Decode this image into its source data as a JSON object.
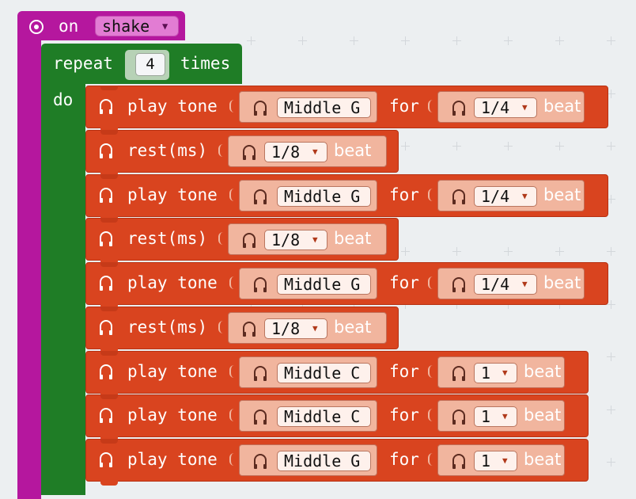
{
  "event": {
    "label": "on",
    "gesture": "shake"
  },
  "repeat": {
    "label": "repeat",
    "count": "4",
    "times_label": "times",
    "do_label": "do"
  },
  "statements": [
    {
      "kind": "tone",
      "label": "play tone",
      "note": "Middle G",
      "for_label": "for",
      "beat": "1/4",
      "beat_label": "beat"
    },
    {
      "kind": "rest",
      "label": "rest(ms)",
      "beat": "1/8",
      "beat_label": "beat"
    },
    {
      "kind": "tone",
      "label": "play tone",
      "note": "Middle G",
      "for_label": "for",
      "beat": "1/4",
      "beat_label": "beat"
    },
    {
      "kind": "rest",
      "label": "rest(ms)",
      "beat": "1/8",
      "beat_label": "beat"
    },
    {
      "kind": "tone",
      "label": "play tone",
      "note": "Middle G",
      "for_label": "for",
      "beat": "1/4",
      "beat_label": "beat"
    },
    {
      "kind": "rest",
      "label": "rest(ms)",
      "beat": "1/8",
      "beat_label": "beat"
    },
    {
      "kind": "tone",
      "label": "play tone",
      "note": "Middle C",
      "for_label": "for",
      "beat": "1",
      "beat_label": "beat"
    },
    {
      "kind": "tone",
      "label": "play tone",
      "note": "Middle C",
      "for_label": "for",
      "beat": "1",
      "beat_label": "beat"
    },
    {
      "kind": "tone",
      "label": "play tone",
      "note": "Middle G",
      "for_label": "for",
      "beat": "1",
      "beat_label": "beat"
    }
  ],
  "colors": {
    "workspace": "#eceff1",
    "event": "#b5179e",
    "loops": "#1f7d26",
    "music": "#d9441f"
  },
  "icons": {
    "event": "radio-target-icon",
    "music": "headphones-icon",
    "dropdown": "triangle-down-icon"
  }
}
